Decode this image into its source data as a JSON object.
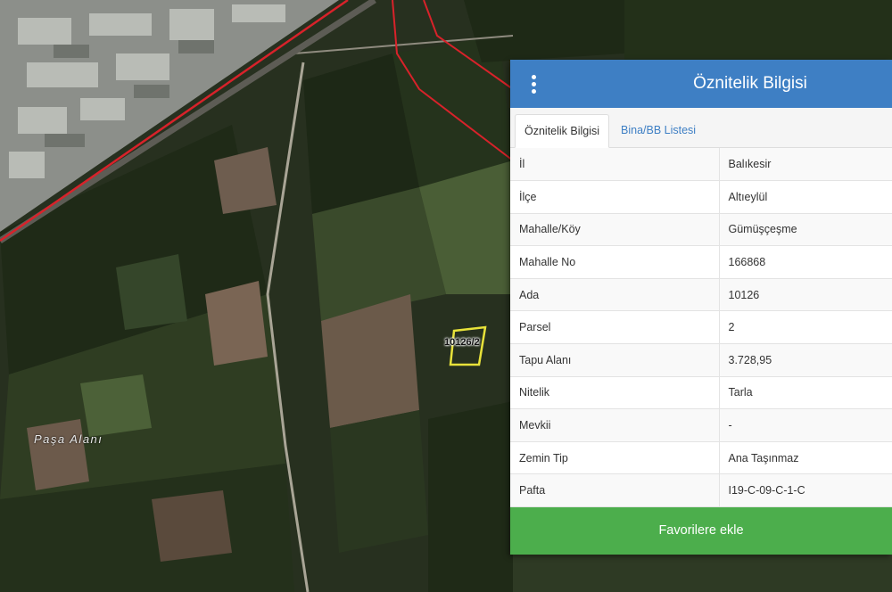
{
  "map": {
    "place_label": "Paşa Alanı",
    "parcel_label": "10126/2"
  },
  "panel": {
    "title": "Öznitelik Bilgisi",
    "menu_icon": "kebab-menu-icon",
    "tabs": [
      {
        "label": "Öznitelik Bilgisi",
        "active": true
      },
      {
        "label": "Bina/BB Listesi",
        "active": false
      }
    ],
    "attributes": [
      {
        "key": "İl",
        "value": "Balıkesir"
      },
      {
        "key": "İlçe",
        "value": "Altıeylül"
      },
      {
        "key": "Mahalle/Köy",
        "value": "Gümüşçeşme"
      },
      {
        "key": "Mahalle No",
        "value": "166868"
      },
      {
        "key": "Ada",
        "value": "10126"
      },
      {
        "key": "Parsel",
        "value": "2"
      },
      {
        "key": "Tapu Alanı",
        "value": "3.728,95"
      },
      {
        "key": "Nitelik",
        "value": "Tarla"
      },
      {
        "key": "Mevkii",
        "value": "-"
      },
      {
        "key": "Zemin Tip",
        "value": "Ana Taşınmaz"
      },
      {
        "key": "Pafta",
        "value": "I19-C-09-C-1-C"
      }
    ],
    "favorite_button": "Favorilere ekle"
  },
  "colors": {
    "header_blue": "#3e7fc4",
    "button_green": "#4cae4c",
    "boundary_red": "#d8222a",
    "parcel_yellow": "#e8e23a"
  }
}
